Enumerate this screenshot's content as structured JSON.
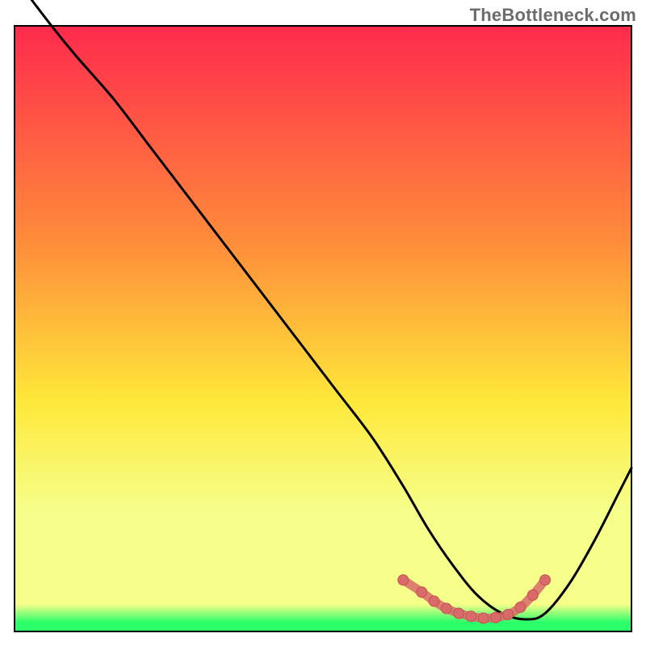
{
  "watermark": "TheBottleneck.com",
  "colors": {
    "gradient_top": "#ff2a4d",
    "gradient_mid1": "#ff8a3a",
    "gradient_mid2": "#ffe83a",
    "gradient_low": "#f6ff8a",
    "gradient_green": "#2bff6a",
    "curve": "#000000",
    "marker_fill": "#d86a6a",
    "marker_stroke": "#c94f4f",
    "border": "#000000"
  },
  "chart_data": {
    "type": "line",
    "title": "",
    "xlabel": "",
    "ylabel": "",
    "xlim": [
      0,
      100
    ],
    "ylim": [
      0,
      100
    ],
    "series": [
      {
        "name": "bottleneck-curve",
        "x": [
          0,
          6,
          10,
          16,
          22,
          28,
          34,
          40,
          46,
          52,
          58,
          63,
          67,
          71,
          75,
          79,
          83,
          86,
          90,
          94,
          98,
          100
        ],
        "y": [
          108,
          100,
          95,
          88,
          80,
          72,
          64,
          56,
          48,
          40,
          32,
          24,
          17,
          11,
          6,
          3,
          2,
          3,
          8,
          15,
          23,
          27
        ]
      }
    ],
    "markers": {
      "name": "bottom-cluster",
      "x": [
        63,
        66,
        68,
        70,
        72,
        74,
        76,
        78,
        80,
        82,
        84,
        86
      ],
      "y": [
        8.5,
        6.5,
        5.0,
        3.8,
        3.0,
        2.5,
        2.2,
        2.3,
        2.8,
        4.0,
        6.0,
        8.5
      ]
    },
    "gradient_stops": [
      {
        "offset": 0.0,
        "key": "gradient_top"
      },
      {
        "offset": 0.35,
        "key": "gradient_mid1"
      },
      {
        "offset": 0.62,
        "key": "gradient_mid2"
      },
      {
        "offset": 0.8,
        "key": "gradient_low"
      },
      {
        "offset": 0.955,
        "key": "gradient_low"
      },
      {
        "offset": 0.985,
        "key": "gradient_green"
      },
      {
        "offset": 1.0,
        "key": "gradient_green"
      }
    ]
  }
}
